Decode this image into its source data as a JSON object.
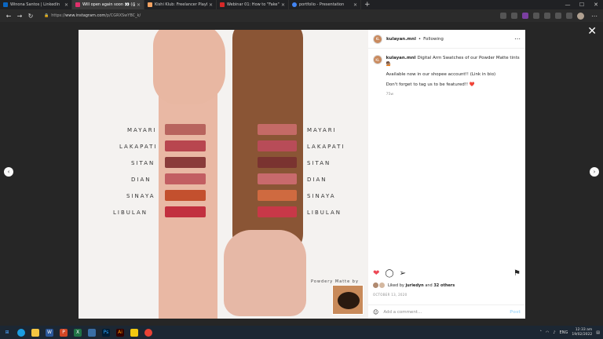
{
  "browser": {
    "tabs": [
      {
        "label": "Winona Santos | LinkedIn",
        "color": "#0a66c2",
        "active": false
      },
      {
        "label": "Will open again soon 👀 (@ku...",
        "color": "#e1306c",
        "active": true
      },
      {
        "label": "Kishi Klub: Freelancer Playbook",
        "color": "#f4a261",
        "active": false
      },
      {
        "label": "Webinar 01: How to \"Fake\" Your...",
        "color": "#d62828",
        "active": false
      },
      {
        "label": "portfolio - Presentation",
        "color": "#4285f4",
        "active": false
      }
    ],
    "new_tab": "+",
    "url_prefix": "https://",
    "url_host": "www.instagram.com",
    "url_path": "/p/CGRXSwYBC_k/"
  },
  "photo": {
    "left_labels": [
      "MAYARI",
      "LAKAPATI",
      "SITAN",
      "DIAN",
      "SINAYA",
      "LIBULAN"
    ],
    "right_labels": [
      "MAYARI",
      "LAKAPATI",
      "SITAN",
      "DIAN",
      "SINAYA",
      "LIBULAN"
    ],
    "left_colors": [
      "#b8645e",
      "#b8464f",
      "#8a3b3a",
      "#c25e62",
      "#c3502e",
      "#c2303f"
    ],
    "right_colors": [
      "#c46a66",
      "#b84c58",
      "#7a3330",
      "#c86a6c",
      "#cf6a40",
      "#c83848"
    ],
    "brand_note": "Powdery Matte by",
    "brand_logo": "Kulayan"
  },
  "post": {
    "avatar_text": "KL",
    "username": "kulayan.mnl",
    "separator": "•",
    "follow_status": "Following",
    "caption_line1": "Digital Arm Swatches of our Powder Matte tints 💁🏽",
    "caption_line2": "Available now in our shopee account!! (Link in bio)",
    "caption_line3": "Don't forget to tag us to be featured!! ❤️",
    "caption_time": "75w",
    "liked_by_prefix": "Liked by",
    "liked_by_user": "juriedyn",
    "liked_by_suffix": "and",
    "liked_by_count": "32 others",
    "date": "OCTOBER 13, 2020",
    "comment_placeholder": "Add a comment...",
    "post_button": "Post"
  },
  "taskbar": {
    "lang": "ENG",
    "time": "12:33 am",
    "date": "19/02/2022"
  }
}
